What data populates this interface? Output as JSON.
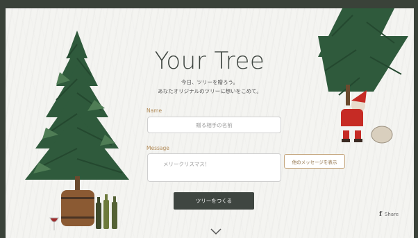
{
  "header": {
    "title": "Your Tree",
    "subtitle_line1": "今日、ツリーを贈ろう。",
    "subtitle_line2": "あなたオリジナルのツリーに想いをこめて。"
  },
  "form": {
    "name_label": "Name",
    "name_placeholder": "贈る相手の名前",
    "message_label": "Message",
    "message_value": "メリークリスマス！",
    "other_messages_button": "他のメッセージを表示",
    "submit_button": "ツリーをつくる"
  },
  "footer": {
    "share_label": "Share",
    "share_icon": "facebook-icon",
    "scroll_icon": "chevron-down-icon"
  },
  "colors": {
    "frame": "#3a4239",
    "background": "#f4f4f1",
    "title": "#3f4641",
    "label_accent": "#b18a57",
    "submit_button": "#3f4641",
    "tree_green": "#2f5a3c"
  }
}
